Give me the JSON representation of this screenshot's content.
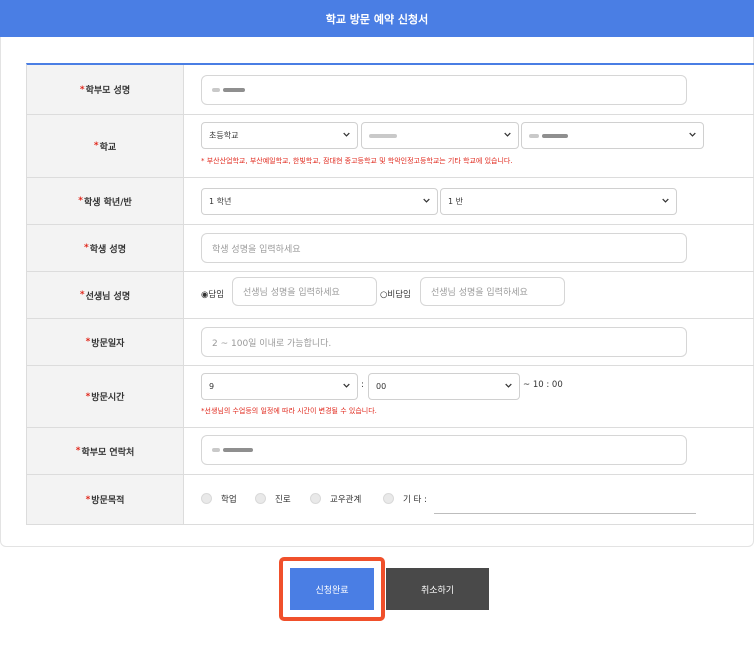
{
  "header": {
    "title": "학교 방문 예약 신청서"
  },
  "rows": {
    "parent_name": {
      "label": "학부모 성명"
    },
    "school": {
      "label": "학교",
      "level_value": "초등학교",
      "notice": "* 부산산업학교, 부산예일학교, 한빛학교, 잠대현 종고등학교 및 학악인정고등학교는 기타 학교에 있습니다."
    },
    "grade_class": {
      "label": "학생 학년/반",
      "grade_value": "1 학년",
      "class_value": "1 반"
    },
    "student_name": {
      "label": "학생 성명",
      "placeholder": "학생 성명을 입력하세요"
    },
    "teacher_name": {
      "label": "선생님 성명",
      "homeroom_label": "◉담임",
      "homeroom_placeholder": "선생님 성명을 입력하세요",
      "non_homeroom_label": "○비담임",
      "non_homeroom_placeholder": "선생님 성명을 입력하세요"
    },
    "visit_date": {
      "label": "방문일자",
      "placeholder": "2 ~ 100일 이내로 가능합니다."
    },
    "visit_time": {
      "label": "방문시간",
      "hour_value": "9",
      "colon": ":",
      "minute_value": "00",
      "end_time": "~ 10 : 00",
      "notice": "*선생님의 수업등의 일정에 따라 시간이 변경될 수 있습니다."
    },
    "parent_phone": {
      "label": " 학부모 연락처"
    },
    "visit_purpose": {
      "label": "방문목적",
      "options": [
        "학업",
        "진로",
        "교우관계",
        "기 타 :"
      ]
    }
  },
  "required_mark": "*",
  "buttons": {
    "submit": "신청완료",
    "cancel": "취소하기"
  },
  "colors": {
    "accent": "#4a7ee4",
    "required": "#e0271b",
    "cancel_bg": "#494949",
    "highlight": "#f0502b"
  }
}
